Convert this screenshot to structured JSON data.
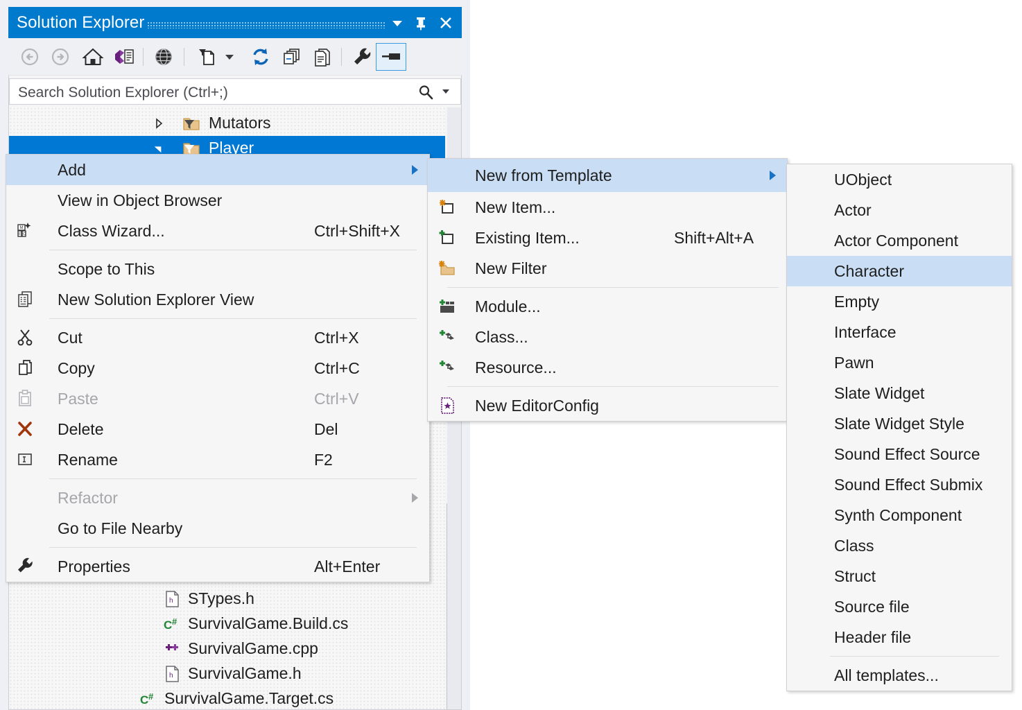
{
  "window": {
    "title": "Solution Explorer",
    "titlebar_color": "#007acc",
    "buttons": [
      {
        "name": "dropdown-menu",
        "icon": "chevron-down-icon"
      },
      {
        "name": "pin",
        "icon": "pin-icon"
      },
      {
        "name": "close",
        "icon": "close-icon"
      }
    ]
  },
  "toolbar": {
    "items": [
      {
        "name": "back",
        "icon": "back-arrow-icon",
        "disabled": true
      },
      {
        "name": "forward",
        "icon": "forward-arrow-icon",
        "disabled": true
      },
      {
        "name": "home",
        "icon": "home-icon",
        "disabled": false
      },
      {
        "name": "solution-view",
        "icon": "vs-solution-icon",
        "disabled": false
      },
      {
        "name": "pending-changes-filter",
        "icon": "globe-filter-icon",
        "disabled": false
      },
      {
        "name": "show-all-files",
        "icon": "file-filter-icon",
        "disabled": false
      },
      {
        "name": "show-all-files-dropdown",
        "icon": "chevron-down-icon",
        "disabled": false
      },
      {
        "name": "refresh",
        "icon": "refresh-icon",
        "disabled": false
      },
      {
        "name": "collapse-all",
        "icon": "collapse-all-icon",
        "disabled": false
      },
      {
        "name": "sync-with-active-document",
        "icon": "sync-document-icon",
        "disabled": false
      },
      {
        "name": "properties",
        "icon": "wrench-icon",
        "disabled": false
      },
      {
        "name": "preview-selected-items",
        "icon": "preview-pane-icon",
        "disabled": false,
        "active": true
      }
    ]
  },
  "search": {
    "placeholder": "Search Solution Explorer (Ctrl+;)",
    "value": "",
    "icon": "search-icon",
    "dropdown_icon": "chevron-down-icon"
  },
  "tree": {
    "rows": [
      {
        "label": "Mutators",
        "icon": "filter-folder-icon",
        "twisty": "collapsed",
        "indent": 212,
        "selected": false
      },
      {
        "label": "Player",
        "icon": "filter-folder-icon",
        "twisty": "expanded",
        "indent": 212,
        "selected": true
      },
      {
        "label": "STypes.h",
        "icon": "header-file-icon",
        "twisty": "none",
        "indent": 222,
        "selected": false
      },
      {
        "label": "SurvivalGame.Build.cs",
        "icon": "csharp-file-icon",
        "twisty": "none",
        "indent": 222,
        "selected": false
      },
      {
        "label": "SurvivalGame.cpp",
        "icon": "cpp-file-icon",
        "twisty": "none",
        "indent": 222,
        "selected": false
      },
      {
        "label": "SurvivalGame.h",
        "icon": "header-file-icon",
        "twisty": "none",
        "indent": 222,
        "selected": false
      },
      {
        "label": "SurvivalGame.Target.cs",
        "icon": "csharp-file-icon",
        "twisty": "none",
        "indent": 188,
        "selected": false
      }
    ]
  },
  "context_menu": {
    "items": [
      {
        "label": "Add",
        "shortcut": "",
        "icon": "",
        "submenu": true,
        "highlighted": true,
        "disabled": false
      },
      {
        "label": "View in Object Browser",
        "shortcut": "",
        "icon": "",
        "submenu": false,
        "highlighted": false,
        "disabled": false
      },
      {
        "label": "Class Wizard...",
        "shortcut": "Ctrl+Shift+X",
        "icon": "class-wizard-icon",
        "submenu": false,
        "highlighted": false,
        "disabled": false
      },
      {
        "separator": true
      },
      {
        "label": "Scope to This",
        "shortcut": "",
        "icon": "",
        "submenu": false,
        "highlighted": false,
        "disabled": false
      },
      {
        "label": "New Solution Explorer View",
        "shortcut": "",
        "icon": "new-view-icon",
        "submenu": false,
        "highlighted": false,
        "disabled": false
      },
      {
        "separator": true
      },
      {
        "label": "Cut",
        "shortcut": "Ctrl+X",
        "icon": "scissors-icon",
        "submenu": false,
        "highlighted": false,
        "disabled": false
      },
      {
        "label": "Copy",
        "shortcut": "Ctrl+C",
        "icon": "copy-icon",
        "submenu": false,
        "highlighted": false,
        "disabled": false
      },
      {
        "label": "Paste",
        "shortcut": "Ctrl+V",
        "icon": "paste-icon",
        "submenu": false,
        "highlighted": false,
        "disabled": true
      },
      {
        "label": "Delete",
        "shortcut": "Del",
        "icon": "delete-x-icon",
        "submenu": false,
        "highlighted": false,
        "disabled": false
      },
      {
        "label": "Rename",
        "shortcut": "F2",
        "icon": "rename-icon",
        "submenu": false,
        "highlighted": false,
        "disabled": false
      },
      {
        "separator": true
      },
      {
        "label": "Refactor",
        "shortcut": "",
        "icon": "",
        "submenu": true,
        "highlighted": false,
        "disabled": true
      },
      {
        "label": "Go to File Nearby",
        "shortcut": "",
        "icon": "",
        "submenu": false,
        "highlighted": false,
        "disabled": false
      },
      {
        "separator": true
      },
      {
        "label": "Properties",
        "shortcut": "Alt+Enter",
        "icon": "wrench-icon",
        "submenu": false,
        "highlighted": false,
        "disabled": false
      }
    ]
  },
  "add_menu": {
    "items": [
      {
        "label": "New from Template",
        "shortcut": "",
        "icon": "",
        "submenu": true,
        "highlighted": true,
        "disabled": false
      },
      {
        "label": "New Item...",
        "shortcut": "",
        "icon": "new-item-icon",
        "submenu": false,
        "highlighted": false,
        "disabled": false
      },
      {
        "label": "Existing Item...",
        "shortcut": "Shift+Alt+A",
        "icon": "existing-item-icon",
        "submenu": false,
        "highlighted": false,
        "disabled": false
      },
      {
        "label": "New Filter",
        "shortcut": "",
        "icon": "new-filter-icon",
        "submenu": false,
        "highlighted": false,
        "disabled": false
      },
      {
        "separator": true
      },
      {
        "label": "Module...",
        "shortcut": "",
        "icon": "module-icon",
        "submenu": false,
        "highlighted": false,
        "disabled": false
      },
      {
        "label": "Class...",
        "shortcut": "",
        "icon": "add-class-icon",
        "submenu": false,
        "highlighted": false,
        "disabled": false
      },
      {
        "label": "Resource...",
        "shortcut": "",
        "icon": "add-resource-icon",
        "submenu": false,
        "highlighted": false,
        "disabled": false
      },
      {
        "separator": true
      },
      {
        "label": "New EditorConfig",
        "shortcut": "",
        "icon": "editorconfig-icon",
        "submenu": false,
        "highlighted": false,
        "disabled": false
      }
    ]
  },
  "template_menu": {
    "items": [
      {
        "label": "UObject",
        "highlighted": false
      },
      {
        "label": "Actor",
        "highlighted": false
      },
      {
        "label": "Actor Component",
        "highlighted": false
      },
      {
        "label": "Character",
        "highlighted": true
      },
      {
        "label": "Empty",
        "highlighted": false
      },
      {
        "label": "Interface",
        "highlighted": false
      },
      {
        "label": "Pawn",
        "highlighted": false
      },
      {
        "label": "Slate Widget",
        "highlighted": false
      },
      {
        "label": "Slate Widget Style",
        "highlighted": false
      },
      {
        "label": "Sound Effect Source",
        "highlighted": false
      },
      {
        "label": "Sound Effect Submix",
        "highlighted": false
      },
      {
        "label": "Synth Component",
        "highlighted": false
      },
      {
        "label": "Class",
        "highlighted": false
      },
      {
        "label": "Struct",
        "highlighted": false
      },
      {
        "label": "Source file",
        "highlighted": false
      },
      {
        "label": "Header file",
        "highlighted": false
      },
      {
        "separator": true
      },
      {
        "label": "All templates...",
        "highlighted": false
      }
    ]
  },
  "colors": {
    "accent": "#007acc",
    "selection": "#0078d4",
    "menu_highlight": "#c9def5",
    "menu_bg": "#f6f6f6"
  }
}
